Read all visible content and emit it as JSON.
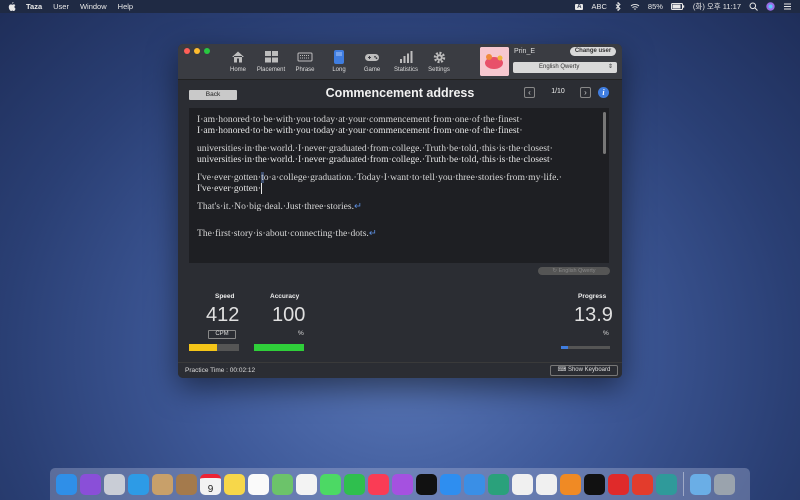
{
  "menubar": {
    "app": "Taza",
    "items": [
      "User",
      "Window",
      "Help"
    ],
    "input_badge": "A",
    "input_source": "ABC",
    "battery": "85%",
    "clock": "(화) 오후 11:17"
  },
  "toolbar": {
    "buttons": [
      {
        "label": "Home",
        "icon": "house-icon"
      },
      {
        "label": "Placement",
        "icon": "grid-icon"
      },
      {
        "label": "Phrase",
        "icon": "keyboard-icon"
      },
      {
        "label": "Long",
        "icon": "book-icon"
      },
      {
        "label": "Game",
        "icon": "gamepad-icon"
      },
      {
        "label": "Statistics",
        "icon": "bar-chart-icon"
      },
      {
        "label": "Settings",
        "icon": "gear-icon"
      }
    ],
    "user_name": "Prin_E",
    "change_user": "Change user",
    "layout": "English Qwerty"
  },
  "content": {
    "back": "Back",
    "title": "Commencement address",
    "page": "1/10",
    "info": "i"
  },
  "text": {
    "l1_ref": "I·am·honored·to·be·with·you·today·at·your·commencement·from·one·of·the·finest·",
    "l1_typed": "I·am·honored·to·be·with·you·today·at·your·commencement·from·one·of·the·finest·",
    "l2_ref": "universities·in·the·world.·I·never·graduated·from·college.·Truth·be·told,·this·is·the·closest·",
    "l2_typed": "universities·in·the·world.·I·never·graduated·from·college.·Truth·be·told,·this·is·the·closest·",
    "l3_ref_a": "I've·ever·gotten·",
    "l3_ref_cursor": "t",
    "l3_ref_b": "o·a·college·graduation.·Today·I·want·to·tell·you·three·stories·from·my·life.·",
    "l3_typed": "I've·ever·gotten·",
    "l4": "That's·it.·No·big·deal.·Just·three·stories.",
    "l5": "The·first·story·is·about·connecting·the·dots.",
    "return_glyph": "↵"
  },
  "keyboard_select": "English Qwerty",
  "stats": {
    "speed_label": "Speed",
    "speed_value": "412",
    "speed_unit": "CPM",
    "speed_fill": 0.55,
    "accuracy_label": "Accuracy",
    "accuracy_value": "100",
    "accuracy_unit": "%",
    "accuracy_fill": 1.0,
    "progress_label": "Progress",
    "progress_value": "13.9",
    "progress_unit": "%",
    "progress_fill": 0.139
  },
  "footer": {
    "practice_time": "Practice Time : 00:02:12",
    "show_keyboard": "Show Keyboard"
  },
  "dock": {
    "apps": [
      {
        "name": "finder",
        "color": "#2f8fe8"
      },
      {
        "name": "siri",
        "color": "#8a4fd8"
      },
      {
        "name": "launchpad",
        "color": "#c9cdd6"
      },
      {
        "name": "safari",
        "color": "#2d9be6"
      },
      {
        "name": "mail",
        "color": "#c8a06a"
      },
      {
        "name": "contacts",
        "color": "#a47a4c"
      },
      {
        "name": "calendar",
        "color": "#f2f2f2"
      },
      {
        "name": "notes",
        "color": "#f7d74a"
      },
      {
        "name": "reminders",
        "color": "#fafafa"
      },
      {
        "name": "maps",
        "color": "#6cc36a"
      },
      {
        "name": "photos",
        "color": "#f3f3f3"
      },
      {
        "name": "messages",
        "color": "#4cd964"
      },
      {
        "name": "facetime",
        "color": "#2fbf4e"
      },
      {
        "name": "music",
        "color": "#fa3c55"
      },
      {
        "name": "podcasts",
        "color": "#a551e0"
      },
      {
        "name": "tv",
        "color": "#111111"
      },
      {
        "name": "app-store",
        "color": "#2e8ef0"
      },
      {
        "name": "xcode",
        "color": "#3a8fe6"
      },
      {
        "name": "maps-alt",
        "color": "#2aa17b"
      },
      {
        "name": "unity",
        "color": "#f0f0f0"
      },
      {
        "name": "taza",
        "color": "#f0f0f0"
      },
      {
        "name": "books",
        "color": "#f08a24"
      },
      {
        "name": "epic-games",
        "color": "#111111"
      },
      {
        "name": "creative-cloud",
        "color": "#e02a2a"
      },
      {
        "name": "parallels",
        "color": "#e33c2c"
      },
      {
        "name": "git",
        "color": "#2f9a9a"
      },
      {
        "name": "downloads",
        "color": "#6aaee6"
      },
      {
        "name": "trash",
        "color": "#9aa3ad"
      }
    ],
    "calendar_day": "9"
  }
}
